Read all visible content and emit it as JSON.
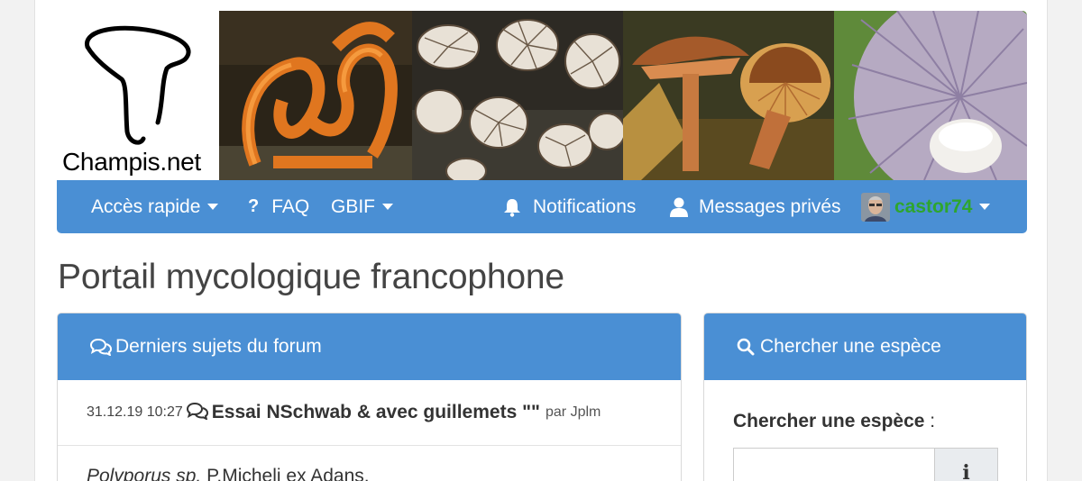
{
  "site": {
    "logo_text": "Champis.net"
  },
  "navbar": {
    "quick_access": "Accès rapide",
    "faq": "FAQ",
    "gbif": "GBIF",
    "notifications": "Notifications",
    "private_messages": "Messages privés",
    "username": "castor74"
  },
  "page_title": "Portail mycologique francophone",
  "forum_panel": {
    "title": "Derniers sujets du forum",
    "rows": [
      {
        "date": "31.12.19 10:27",
        "title": "Essai NSchwab & avec guillemets \"\"",
        "by": "par Jplm"
      }
    ],
    "next_row_species": "Polyporus sp.",
    "next_row_author": "P.Micheli ex Adans."
  },
  "search_panel": {
    "title": "Chercher une espèce",
    "label": "Chercher une espèce",
    "label_suffix": " :",
    "input_value": "",
    "info_button": "i"
  },
  "colors": {
    "accent": "#4a8fd4",
    "username": "#2ea52e"
  }
}
